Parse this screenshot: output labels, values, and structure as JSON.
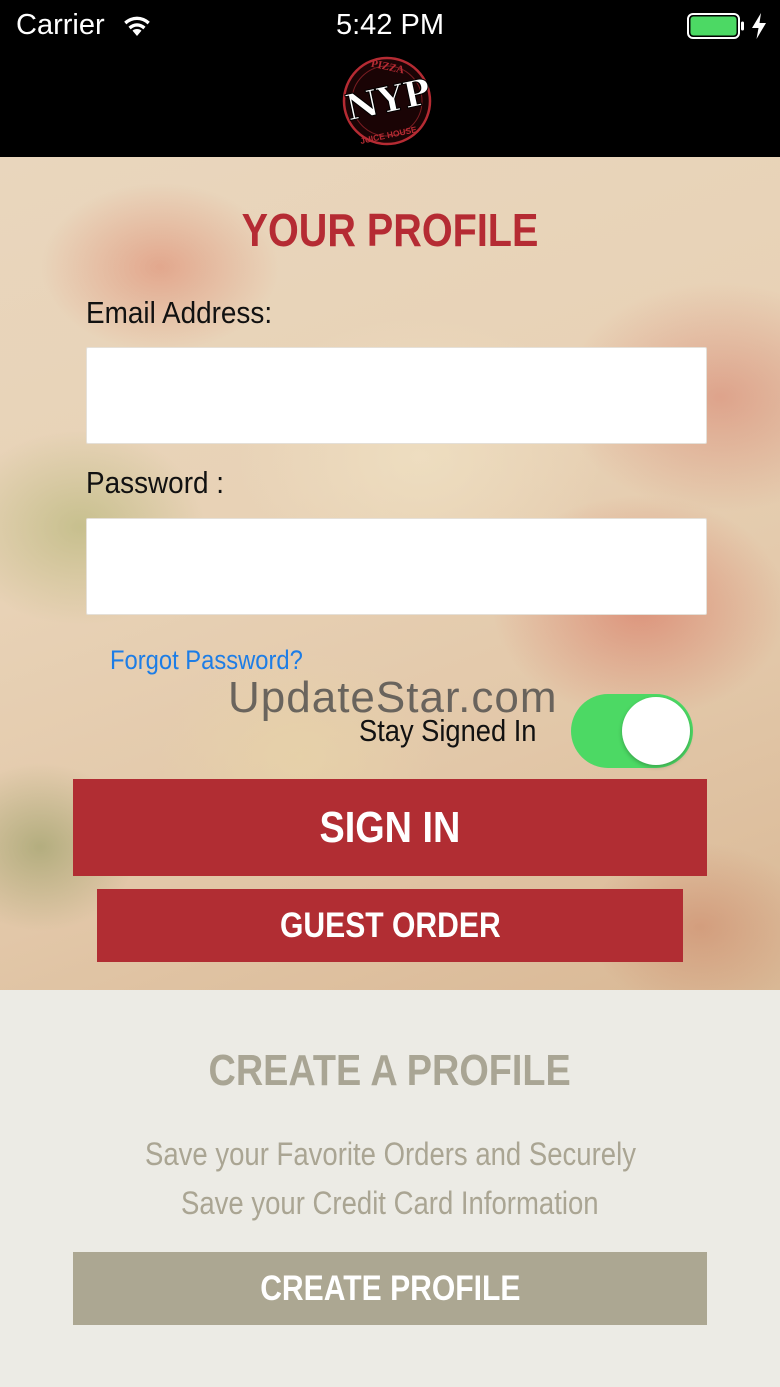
{
  "status_bar": {
    "carrier": "Carrier",
    "time": "5:42 PM",
    "battery_color": "#4cd964"
  },
  "header": {
    "logo": {
      "text": "NYP",
      "top_text": "PIZZA",
      "bottom_text": "JUICE HOUSE",
      "color": "#b52b33"
    }
  },
  "profile": {
    "title": "YOUR PROFILE",
    "email_label": "Email Address:",
    "email_value": "",
    "password_label": "Password :",
    "password_value": "",
    "forgot_link": "Forgot Password?",
    "watermark": "UpdateStar.com",
    "stay_signed_in_label": "Stay Signed In",
    "stay_signed_in_on": true,
    "sign_in_button": "SIGN IN",
    "guest_order_button": "GUEST ORDER"
  },
  "create_profile": {
    "title": "CREATE A PROFILE",
    "description_line1": "Save your Favorite Orders and Securely",
    "description_line2": "Save your Credit Card Information",
    "button": "CREATE PROFILE"
  },
  "colors": {
    "brand_red": "#b12d33",
    "link_blue": "#1d7de6",
    "toggle_green": "#4cd964",
    "muted_khaki": "#aca792",
    "panel_bg": "#ecebe5"
  }
}
